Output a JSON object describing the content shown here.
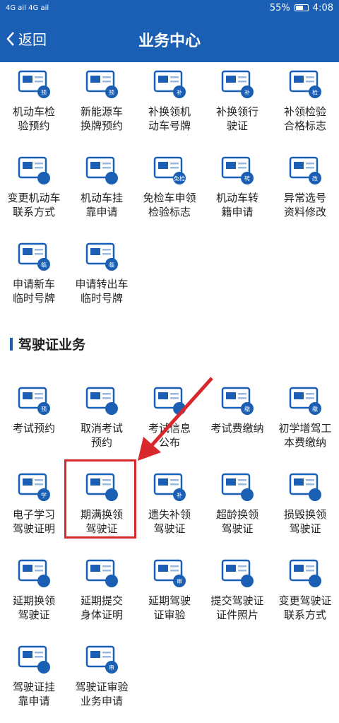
{
  "status": {
    "battery": "55%",
    "time": "4:08",
    "net": "4G ail 4G ail"
  },
  "header": {
    "back_label": "返回",
    "title": "业务中心"
  },
  "vehicle_items": [
    {
      "label": "机动车检\n验预约",
      "badge": "预"
    },
    {
      "label": "新能源车\n换牌预约",
      "badge": "预"
    },
    {
      "label": "补换领机\n动车号牌",
      "badge": "补"
    },
    {
      "label": "补换领行\n驶证",
      "badge": "补"
    },
    {
      "label": "补领检验\n合格标志",
      "badge": "检"
    },
    {
      "label": "变更机动车\n联系方式",
      "badge": ""
    },
    {
      "label": "机动车挂\n靠申请",
      "badge": ""
    },
    {
      "label": "免检车申领\n检验标志",
      "badge": "免检"
    },
    {
      "label": "机动车转\n籍申请",
      "badge": "转"
    },
    {
      "label": "异常选号\n资料修改",
      "badge": "改"
    },
    {
      "label": "申请新车\n临时号牌",
      "badge": "临"
    },
    {
      "label": "申请转出车\n临时号牌",
      "badge": "临"
    }
  ],
  "section": {
    "title": "驾驶证业务"
  },
  "license_items": [
    {
      "label": "考试预约",
      "badge": "预"
    },
    {
      "label": "取消考试\n预约",
      "badge": ""
    },
    {
      "label": "考试信息\n公布",
      "badge": ""
    },
    {
      "label": "考试费缴纳",
      "badge": "缴"
    },
    {
      "label": "初学增驾工\n本费缴纳",
      "badge": "缴"
    },
    {
      "label": "电子学习\n驾驶证明",
      "badge": "学"
    },
    {
      "label": "期满换领\n驾驶证",
      "badge": ""
    },
    {
      "label": "遗失补领\n驾驶证",
      "badge": "补"
    },
    {
      "label": "超龄换领\n驾驶证",
      "badge": ""
    },
    {
      "label": "损毁换领\n驾驶证",
      "badge": ""
    },
    {
      "label": "延期换领\n驾驶证",
      "badge": ""
    },
    {
      "label": "延期提交\n身体证明",
      "badge": ""
    },
    {
      "label": "延期驾驶\n证审验",
      "badge": "审"
    },
    {
      "label": "提交驾驶证\n证件照片",
      "badge": ""
    },
    {
      "label": "变更驾驶证\n联系方式",
      "badge": ""
    },
    {
      "label": "驾驶证挂\n靠申请",
      "badge": ""
    },
    {
      "label": "驾驶证审验\n业务申请",
      "badge": "审"
    }
  ],
  "colors": {
    "primary": "#1a5fb4",
    "highlight": "#d8282e"
  }
}
